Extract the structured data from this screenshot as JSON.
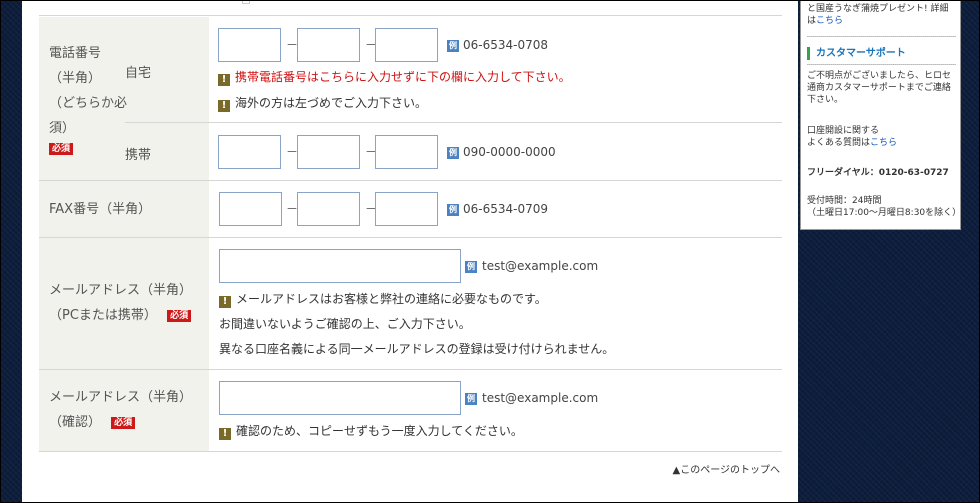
{
  "sidebar": {
    "promo_line1": "と国産うなぎ蒲焼プレゼント! 詳細",
    "promo_line2_prefix": "は",
    "promo_link": "こちら",
    "support_title": "カスタマーサポート",
    "support_desc": [
      "ご不明点がございましたら、ヒロセ",
      "通商カスタマーサポートまでご連絡",
      "下さい。"
    ],
    "faq_line1": "口座開設に関する",
    "faq_line2_prefix": "よくある質問は",
    "faq_link": "こちら",
    "free_dial": "フリーダイヤル：0120-63-0727",
    "hours_line1": "受付時間：24時間",
    "hours_line2": "（土曜日17:00〜月曜日8:30を除く）"
  },
  "form": {
    "required_badge": "必須",
    "example_badge": "例",
    "phone": {
      "label_lines": [
        "電話番号",
        "（半角）",
        "（どちらか必",
        "須）"
      ],
      "home_label": "自宅",
      "mobile_label": "携帯",
      "home_example": "06-6534-0708",
      "mobile_example": "090-0000-0000",
      "home_note_red": "携帯電話番号はこちらに入力せずに下の欄に入力して下さい。",
      "home_note": "海外の方は左づめでご入力下さい。"
    },
    "fax": {
      "label": "FAX番号（半角）",
      "example": "06-6534-0709"
    },
    "email": {
      "label_line1": "メールアドレス（半角）",
      "label_line2": "（PCまたは携帯）",
      "example": "test@example.com",
      "note1": "メールアドレスはお客様と弊社の連絡に必要なものです。",
      "note2": "お間違いないようご確認の上、ご入力下さい。",
      "note3": "異なる口座名義による同一メールアドレスの登録は受け付けられません。"
    },
    "email_confirm": {
      "label_line1": "メールアドレス（半角）",
      "label_line2": "（確認）",
      "example": "test@example.com",
      "note": "確認のため、コピーせずもう一度入力してください。"
    },
    "dash": "－",
    "warn_icon": "!"
  },
  "page_top": "▲このページのトップへ"
}
